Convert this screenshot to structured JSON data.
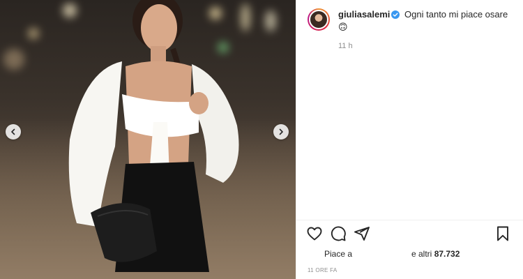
{
  "post": {
    "author": {
      "username": "giuliasalemi",
      "verified": true
    },
    "caption": "Ogni tanto mi piace osare",
    "caption_emoji": "🙃",
    "time_ago": "11 h",
    "likes": {
      "prefix": "Piace a",
      "suffix_text": "e altri",
      "count": "87.732"
    },
    "date": "11 ORE FA"
  },
  "icons": {
    "carousel_prev": "chevron-left-icon",
    "carousel_next": "chevron-right-icon",
    "like": "heart-icon",
    "comment": "comment-icon",
    "share": "share-icon",
    "save": "bookmark-icon"
  },
  "colors": {
    "text": "#262626",
    "muted": "#8e8e8e",
    "verified_blue": "#3897f0",
    "divider": "#efefef"
  }
}
